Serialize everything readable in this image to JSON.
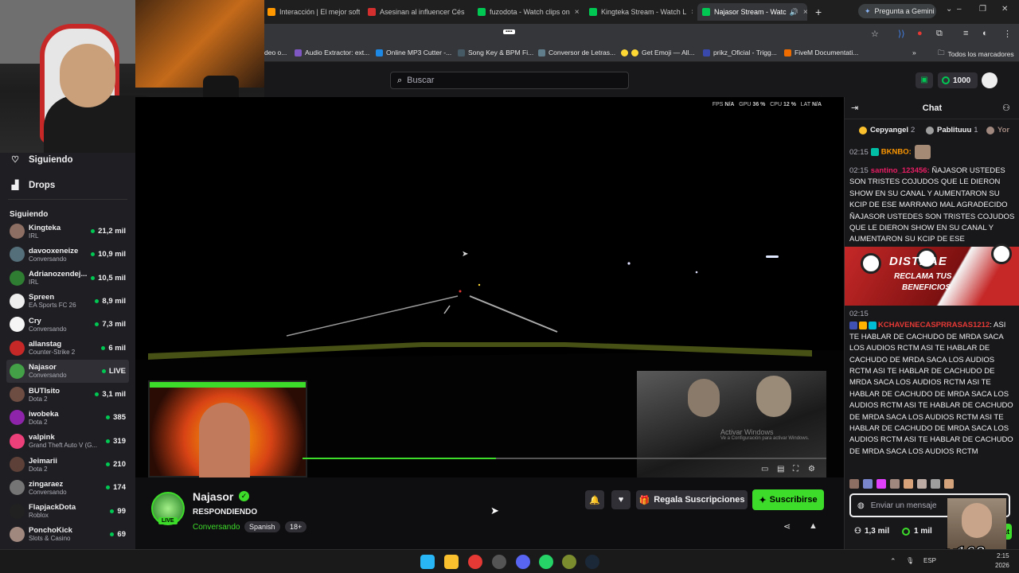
{
  "browser": {
    "tabs": [
      {
        "label": "Interacción | El mejor softw",
        "color": "#ff9800"
      },
      {
        "label": "Asesinan al influencer Cés",
        "color": "#d32f2f"
      },
      {
        "label": "fuzodota - Watch clips on",
        "color": "#00c853"
      },
      {
        "label": "Kingteka Stream - Watch L",
        "color": "#00c853"
      },
      {
        "label": "Najasor Stream - Watc",
        "color": "#00c853"
      }
    ],
    "new_tab": "+",
    "gemini_label": "Pregunta a Gemini",
    "bookmarks": [
      {
        "label": "deo o...",
        "color": "#888888"
      },
      {
        "label": "Audio Extractor: ext...",
        "color": "#7e57c2"
      },
      {
        "label": "Online MP3 Cutter -...",
        "color": "#1e88e5"
      },
      {
        "label": "Song Key & BPM Fi...",
        "color": "#455a64"
      },
      {
        "label": "Conversor de Letras...",
        "color": "#607d8b"
      },
      {
        "label": "Get Emoji — All...",
        "color": "#fdd835"
      },
      {
        "label": "prikz_Oficial - Trigg...",
        "color": "#3949ab"
      },
      {
        "label": "FiveM Documentati...",
        "color": "#ef6c00"
      }
    ],
    "all_bookmarks": "Todos los marcadores"
  },
  "header": {
    "search_placeholder": "Buscar",
    "bits": "1000"
  },
  "sidebar": {
    "nav": [
      {
        "label": "Siguiendo",
        "icon": "heart-icon"
      },
      {
        "label": "Drops",
        "icon": "drops-icon"
      }
    ],
    "following_heading": "Siguiendo",
    "channels": [
      {
        "name": "Kingteka",
        "game": "IRL",
        "viewers": "21,2 mil",
        "color": "#8d6e63"
      },
      {
        "name": "davooxeneize",
        "game": "Conversando",
        "viewers": "10,9 mil",
        "color": "#546e7a"
      },
      {
        "name": "Adrianozendej...",
        "game": "IRL",
        "viewers": "10,5 mil",
        "color": "#2e7d32"
      },
      {
        "name": "Spreen",
        "game": "EA Sports FC 26",
        "viewers": "8,9 mil",
        "color": "#eeeeee"
      },
      {
        "name": "Cry",
        "game": "Conversando",
        "viewers": "7,3 mil",
        "color": "#f5f5f5"
      },
      {
        "name": "allanstag",
        "game": "Counter-Strike 2",
        "viewers": "6 mil",
        "color": "#c62828"
      },
      {
        "name": "Najasor",
        "game": "Conversando",
        "viewers": "LIVE",
        "color": "#43a047"
      },
      {
        "name": "BUTIsito",
        "game": "Dota 2",
        "viewers": "3,1 mil",
        "color": "#6d4c41"
      },
      {
        "name": "iwobeka",
        "game": "Dota 2",
        "viewers": "385",
        "color": "#8e24aa"
      },
      {
        "name": "valpink",
        "game": "Grand Theft Auto V (G...",
        "viewers": "319",
        "color": "#ec407a"
      },
      {
        "name": "Jeimarii",
        "game": "Dota 2",
        "viewers": "210",
        "color": "#5d4037"
      },
      {
        "name": "zingaraez",
        "game": "Conversando",
        "viewers": "174",
        "color": "#757575"
      },
      {
        "name": "FlapjackDota",
        "game": "Roblox",
        "viewers": "99",
        "color": "#212121"
      },
      {
        "name": "PonchoKick",
        "game": "Slots & Casino",
        "viewers": "69",
        "color": "#a1887f"
      }
    ]
  },
  "player": {
    "stats": [
      {
        "k": "FPS",
        "v": "N/A"
      },
      {
        "k": "GPU",
        "v": "36 %"
      },
      {
        "k": "CPU",
        "v": "12 %"
      },
      {
        "k": "LAT",
        "v": "N/A"
      }
    ],
    "pip_watermark_1": "Activar Windows",
    "pip_watermark_2": "Ve a Configuración para activar Windows.",
    "progress": 0.37
  },
  "channel": {
    "name": "Najasor",
    "live": "LIVE",
    "title": "RESPONDIENDO",
    "category": "Conversando",
    "tags": [
      "Spanish",
      "18+"
    ],
    "gift_label": "Regala Suscripciones",
    "subscribe_label": "Suscribirse"
  },
  "chat": {
    "title": "Chat",
    "leaderboard": [
      {
        "name": "Cepyangel",
        "rank": "2",
        "color": "#fbc02d"
      },
      {
        "name": "Pablituuu",
        "rank": "1",
        "color": "#9e9e9e"
      },
      {
        "name": "Yor",
        "rank": "",
        "color": "#a1887f"
      }
    ],
    "messages": [
      {
        "time": "02:15",
        "user": "BKNBO:",
        "color": "#ff9800",
        "text": ""
      },
      {
        "time": "02:15",
        "user": "santino_123456:",
        "color": "#e91e63",
        "text": "ÑAJASOR USTEDES SON TRISTES COJUDOS QUE LE DIERON SHOW EN SU CANAL Y AUMENTARON SU KCIP DE ESE MARRANO MAL AGRADECIDO ÑAJASOR USTEDES SON TRISTES COJUDOS QUE LE DIERON SHOW EN SU CANAL Y AUMENTARON SU KCIP DE ESE"
      },
      {
        "time": "02:15",
        "user": "KCHAVENECASPRRASAS1212",
        "color": "#e53935",
        "text": "ASI TE HABLAR DE CACHUDO DE MRDA SACA LOS AUDIOS RCTM ASI TE HABLAR DE CACHUDO DE MRDA SACA LOS AUDIOS RCTM ASI TE HABLAR DE CACHUDO DE MRDA SACA LOS AUDIOS RCTM ASI TE HABLAR DE CACHUDO DE MRDA SACA LOS AUDIOS RCTM ASI TE HABLAR DE CACHUDO DE MRDA SACA LOS AUDIOS RCTM ASI TE HABLAR DE CACHUDO DE MRDA SACA LOS AUDIOS RCTM ASI TE HABLAR DE CACHUDO DE MRDA SACA LOS AUDIOS RCTM"
      }
    ],
    "promo_line_1": "DISTRAE",
    "promo_line_2": "RECLAMA TUS",
    "promo_line_3": "BENEFICIOS",
    "input_placeholder": "Enviar un mensaje",
    "viewers": "1,3 mil",
    "points": "1 mil",
    "send": "Chat"
  },
  "overlay": {
    "meme_label": "x163"
  },
  "taskbar": {
    "lang": "ESP",
    "time": "2:15",
    "date": "2026"
  }
}
